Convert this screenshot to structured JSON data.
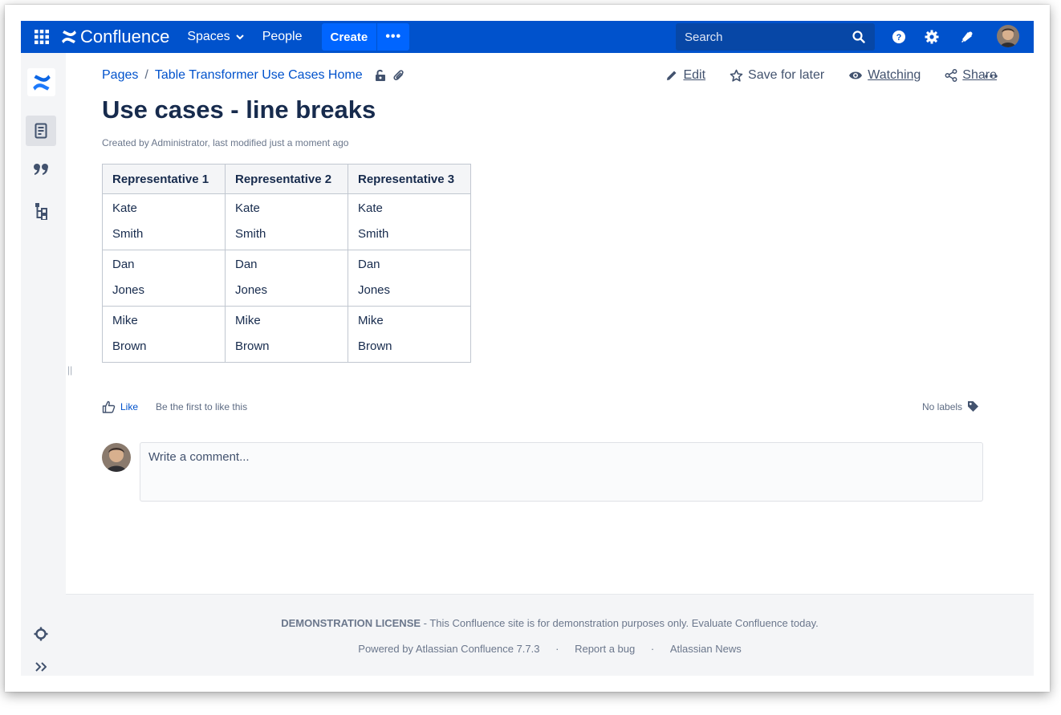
{
  "topnav": {
    "product": "Confluence",
    "spaces": "Spaces",
    "people": "People",
    "create": "Create",
    "more": "•••",
    "search_placeholder": "Search"
  },
  "breadcrumb": {
    "pages": "Pages",
    "separator": "/",
    "parent": "Table Transformer Use Cases Home"
  },
  "actions": {
    "edit": "Edit",
    "save_for_later": "Save for later",
    "watching": "Watching",
    "share": "Share"
  },
  "page": {
    "title": "Use cases - line breaks",
    "byline": "Created by Administrator, last modified just a moment ago"
  },
  "table": {
    "headers": [
      "Representative 1",
      "Representative 2",
      "Representative 3"
    ],
    "rows": [
      [
        [
          "Kate",
          "Smith"
        ],
        [
          "Kate",
          "Smith"
        ],
        [
          "Kate",
          "Smith"
        ]
      ],
      [
        [
          "Dan",
          "Jones"
        ],
        [
          "Dan",
          "Jones"
        ],
        [
          "Dan",
          "Jones"
        ]
      ],
      [
        [
          "Mike",
          "Brown"
        ],
        [
          "Mike",
          "Brown"
        ],
        [
          "Mike",
          "Brown"
        ]
      ]
    ]
  },
  "likes": {
    "like": "Like",
    "first": "Be the first to like this",
    "labels": "No labels"
  },
  "comment": {
    "placeholder": "Write a comment..."
  },
  "footer": {
    "license_bold": "DEMONSTRATION LICENSE",
    "license_text": " - This Confluence site is for demonstration purposes only. Evaluate Confluence today.",
    "powered": "Powered by Atlassian Confluence 7.7.3",
    "dot": "·",
    "report": "Report a bug",
    "news": "Atlassian News"
  },
  "colors": {
    "nav": "#0052cc",
    "create": "#0065ff",
    "link": "#0052cc"
  }
}
